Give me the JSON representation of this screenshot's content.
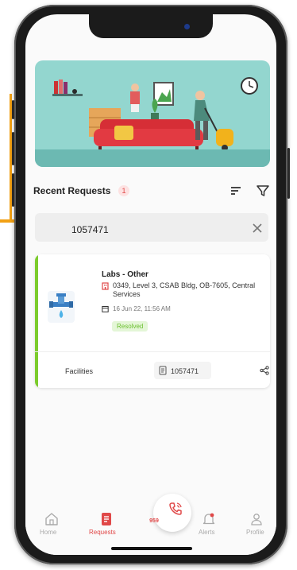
{
  "requests": {
    "section_title": "Recent Requests",
    "count": "1",
    "search_value": "1057471"
  },
  "card": {
    "title": "Labs - Other",
    "location": "0349, Level 3, CSAB Bldg, OB-7605, Central Services",
    "date": "16 Jun 22, 11:56 AM",
    "status": "Resolved",
    "category": "Facilities",
    "request_number": "1057471"
  },
  "call": {
    "label": "959"
  },
  "tabs": [
    {
      "label": "Home",
      "icon": "home-icon"
    },
    {
      "label": "Requests",
      "icon": "requests-icon",
      "active": true
    },
    {
      "label": "Alerts",
      "icon": "bell-icon"
    },
    {
      "label": "Profile",
      "icon": "profile-icon"
    }
  ],
  "colors": {
    "accent": "#e04848",
    "annotation_arrow": "#f2a114",
    "status_resolved": "#6abf2f",
    "card_accent": "#7ccc2c",
    "hero_background": "#93d6cf"
  }
}
